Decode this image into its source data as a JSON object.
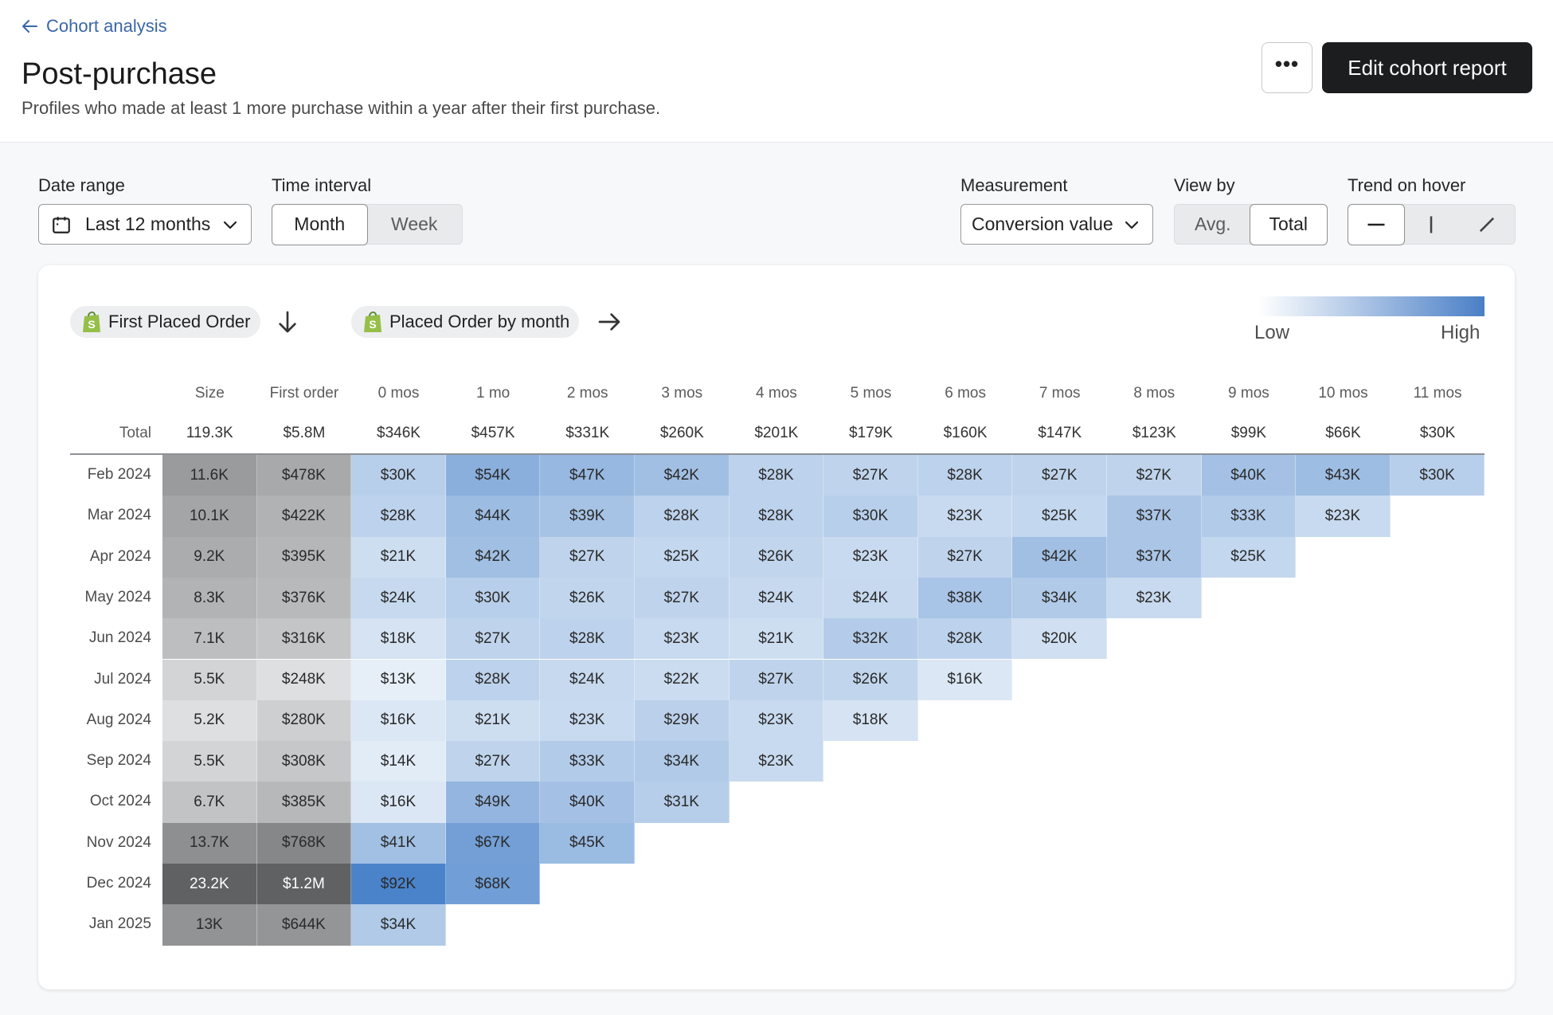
{
  "header": {
    "back_label": "Cohort analysis",
    "title": "Post-purchase",
    "subtitle": "Profiles who made at least 1 more purchase within a year after their first purchase.",
    "more_label": "•••",
    "edit_label": "Edit cohort report"
  },
  "controls": {
    "date_range": {
      "label": "Date range",
      "value": "Last 12 months"
    },
    "time_interval": {
      "label": "Time interval",
      "options": [
        "Month",
        "Week"
      ],
      "selected": "Month"
    },
    "measurement": {
      "label": "Measurement",
      "value": "Conversion value"
    },
    "view_by": {
      "label": "View by",
      "options": [
        "Avg.",
        "Total"
      ],
      "selected": "Total"
    },
    "trend_on_hover": {
      "label": "Trend on hover",
      "options": [
        "horizontal-trend",
        "vertical-trend",
        "diagonal-trend"
      ],
      "selected": "horizontal-trend"
    }
  },
  "chips": {
    "row_metric": "First Placed Order",
    "column_metric": "Placed Order by month"
  },
  "legend": {
    "low": "Low",
    "high": "High",
    "low_color": "#ffffff",
    "high_color": "#4a7fc6"
  },
  "chart_data": {
    "type": "heatmap",
    "title": "Post-purchase",
    "columns": [
      "Size",
      "First order",
      "0 mos",
      "1 mo",
      "2 mos",
      "3 mos",
      "4 mos",
      "5 mos",
      "6 mos",
      "7 mos",
      "8 mos",
      "9 mos",
      "10 mos",
      "11 mos"
    ],
    "total_label": "Total",
    "totals": [
      "119.3K",
      "$5.8M",
      "$346K",
      "$457K",
      "$331K",
      "$260K",
      "$201K",
      "$179K",
      "$160K",
      "$147K",
      "$123K",
      "$99K",
      "$66K",
      "$30K"
    ],
    "rows": [
      {
        "label": "Feb 2024",
        "size": "11.6K",
        "first_order": "$478K",
        "values": [
          "$30K",
          "$54K",
          "$47K",
          "$42K",
          "$28K",
          "$27K",
          "$28K",
          "$27K",
          "$27K",
          "$40K",
          "$43K",
          "$30K"
        ]
      },
      {
        "label": "Mar 2024",
        "size": "10.1K",
        "first_order": "$422K",
        "values": [
          "$28K",
          "$44K",
          "$39K",
          "$28K",
          "$28K",
          "$30K",
          "$23K",
          "$25K",
          "$37K",
          "$33K",
          "$23K"
        ]
      },
      {
        "label": "Apr 2024",
        "size": "9.2K",
        "first_order": "$395K",
        "values": [
          "$21K",
          "$42K",
          "$27K",
          "$25K",
          "$26K",
          "$23K",
          "$27K",
          "$42K",
          "$37K",
          "$25K"
        ]
      },
      {
        "label": "May 2024",
        "size": "8.3K",
        "first_order": "$376K",
        "values": [
          "$24K",
          "$30K",
          "$26K",
          "$27K",
          "$24K",
          "$24K",
          "$38K",
          "$34K",
          "$23K"
        ]
      },
      {
        "label": "Jun 2024",
        "size": "7.1K",
        "first_order": "$316K",
        "values": [
          "$18K",
          "$27K",
          "$28K",
          "$23K",
          "$21K",
          "$32K",
          "$28K",
          "$20K"
        ]
      },
      {
        "label": "Jul 2024",
        "size": "5.5K",
        "first_order": "$248K",
        "values": [
          "$13K",
          "$28K",
          "$24K",
          "$22K",
          "$27K",
          "$26K",
          "$16K"
        ]
      },
      {
        "label": "Aug 2024",
        "size": "5.2K",
        "first_order": "$280K",
        "values": [
          "$16K",
          "$21K",
          "$23K",
          "$29K",
          "$23K",
          "$18K"
        ]
      },
      {
        "label": "Sep 2024",
        "size": "5.5K",
        "first_order": "$308K",
        "values": [
          "$14K",
          "$27K",
          "$33K",
          "$34K",
          "$23K"
        ]
      },
      {
        "label": "Oct 2024",
        "size": "6.7K",
        "first_order": "$385K",
        "values": [
          "$16K",
          "$49K",
          "$40K",
          "$31K"
        ]
      },
      {
        "label": "Nov 2024",
        "size": "13.7K",
        "first_order": "$768K",
        "values": [
          "$41K",
          "$67K",
          "$45K"
        ]
      },
      {
        "label": "Dec 2024",
        "size": "23.2K",
        "first_order": "$1.2M",
        "values": [
          "$92K",
          "$68K"
        ]
      },
      {
        "label": "Jan 2025",
        "size": "13K",
        "first_order": "$644K",
        "values": [
          "$34K"
        ]
      }
    ]
  }
}
